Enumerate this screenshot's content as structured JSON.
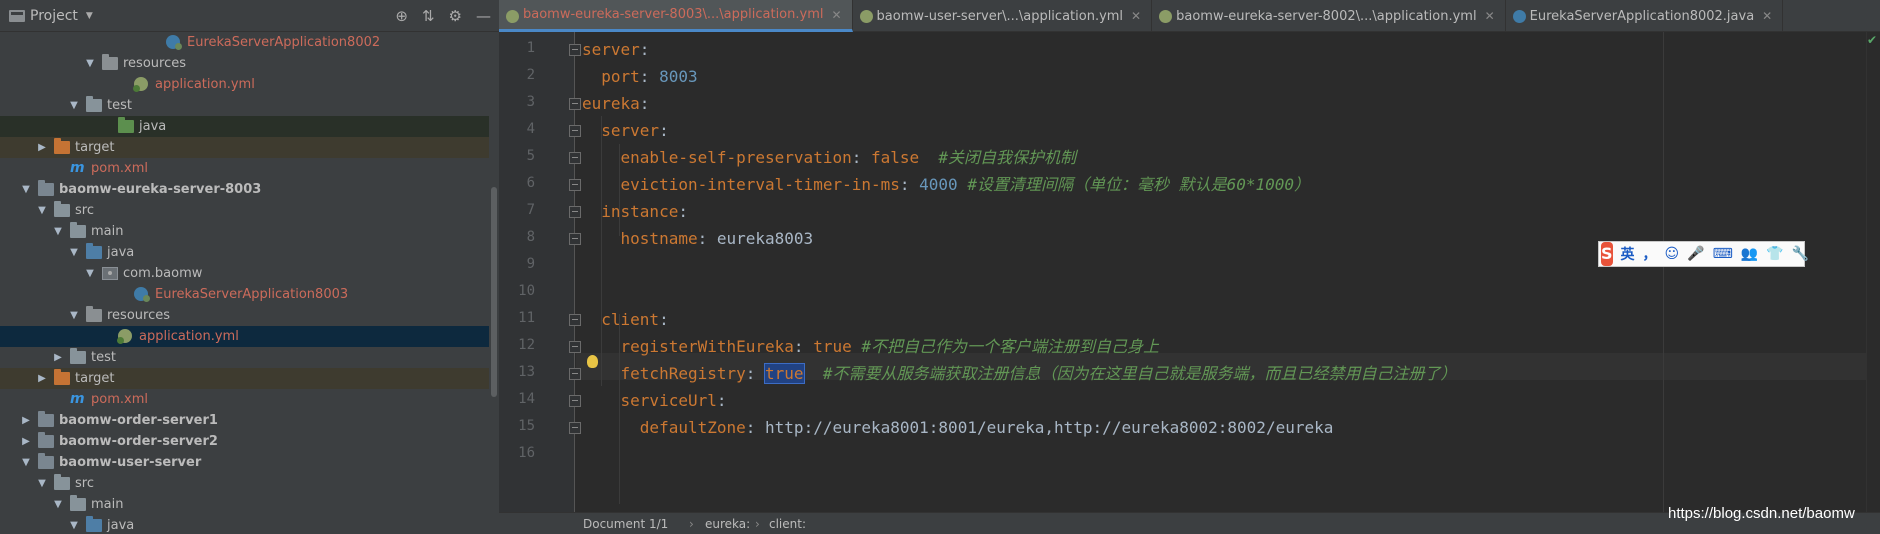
{
  "project_panel": {
    "title": "Project",
    "tools": [
      "target-icon",
      "collapse-icon",
      "gear-icon",
      "hide-icon"
    ],
    "tree": [
      {
        "indent": 9,
        "type": "class",
        "label": "EurekaServerApplication8002",
        "color": "red"
      },
      {
        "indent": 5,
        "arrow": "open",
        "type": "res",
        "label": "resources"
      },
      {
        "indent": 7,
        "type": "yml",
        "label": "application.yml",
        "color": "red"
      },
      {
        "indent": 4,
        "arrow": "open",
        "type": "folder",
        "label": "test"
      },
      {
        "indent": 6,
        "type": "green",
        "label": "java",
        "style": "hl"
      },
      {
        "indent": 2,
        "arrow": "closed",
        "type": "target",
        "label": "target",
        "style": "hl2"
      },
      {
        "indent": 3,
        "type": "maven",
        "label": "pom.xml",
        "color": "red"
      },
      {
        "indent": 1,
        "arrow": "open",
        "type": "module",
        "label": "baomw-eureka-server-8003",
        "bold": true
      },
      {
        "indent": 2,
        "arrow": "open",
        "type": "folder",
        "label": "src"
      },
      {
        "indent": 3,
        "arrow": "open",
        "type": "folder",
        "label": "main"
      },
      {
        "indent": 4,
        "arrow": "open",
        "type": "src",
        "label": "java"
      },
      {
        "indent": 5,
        "arrow": "open",
        "type": "pkg",
        "label": "com.baomw"
      },
      {
        "indent": 7,
        "type": "class",
        "label": "EurekaServerApplication8003",
        "color": "red"
      },
      {
        "indent": 4,
        "arrow": "open",
        "type": "res",
        "label": "resources"
      },
      {
        "indent": 6,
        "type": "yml",
        "label": "application.yml",
        "color": "red",
        "style": "sel"
      },
      {
        "indent": 3,
        "arrow": "closed",
        "type": "folder",
        "label": "test"
      },
      {
        "indent": 2,
        "arrow": "closed",
        "type": "target",
        "label": "target",
        "style": "hl2"
      },
      {
        "indent": 3,
        "type": "maven",
        "label": "pom.xml",
        "color": "red"
      },
      {
        "indent": 1,
        "arrow": "closed",
        "type": "module",
        "label": "baomw-order-server1",
        "bold": true
      },
      {
        "indent": 1,
        "arrow": "closed",
        "type": "module",
        "label": "baomw-order-server2",
        "bold": true
      },
      {
        "indent": 1,
        "arrow": "open",
        "type": "module",
        "label": "baomw-user-server",
        "bold": true
      },
      {
        "indent": 2,
        "arrow": "open",
        "type": "folder",
        "label": "src"
      },
      {
        "indent": 3,
        "arrow": "open",
        "type": "folder",
        "label": "main"
      },
      {
        "indent": 4,
        "arrow": "open",
        "type": "src",
        "label": "java"
      }
    ]
  },
  "tabs": [
    {
      "label": "baomw-eureka-server-8003\\...\\application.yml",
      "icon": "yml",
      "active": true
    },
    {
      "label": "baomw-user-server\\...\\application.yml",
      "icon": "yml"
    },
    {
      "label": "baomw-eureka-server-8002\\...\\application.yml",
      "icon": "yml"
    },
    {
      "label": "EurekaServerApplication8002.java",
      "icon": "java"
    }
  ],
  "editor": {
    "line_numbers": [
      "1",
      "2",
      "3",
      "4",
      "5",
      "6",
      "7",
      "8",
      "9",
      "10",
      "11",
      "12",
      "13",
      "14",
      "15",
      "16"
    ],
    "lines": [
      [
        {
          "t": "server",
          "c": "k"
        },
        {
          "t": ":",
          "c": "p"
        }
      ],
      [
        {
          "t": "  port",
          "c": "k"
        },
        {
          "t": ": ",
          "c": "p"
        },
        {
          "t": "8003",
          "c": "n"
        }
      ],
      [
        {
          "t": "eureka",
          "c": "k"
        },
        {
          "t": ":",
          "c": "p"
        }
      ],
      [
        {
          "t": "  server",
          "c": "k"
        },
        {
          "t": ":",
          "c": "p"
        }
      ],
      [
        {
          "t": "    enable-self-preservation",
          "c": "k"
        },
        {
          "t": ": ",
          "c": "p"
        },
        {
          "t": "false",
          "c": "b"
        },
        {
          "t": "  #关闭自我保护机制",
          "c": "c"
        }
      ],
      [
        {
          "t": "    eviction-interval-timer-in-ms",
          "c": "k"
        },
        {
          "t": ": ",
          "c": "p"
        },
        {
          "t": "4000",
          "c": "n"
        },
        {
          "t": " #设置清理间隔（单位：毫秒 默认是60*1000）",
          "c": "c"
        }
      ],
      [
        {
          "t": "  instance",
          "c": "k"
        },
        {
          "t": ":",
          "c": "p"
        }
      ],
      [
        {
          "t": "    hostname",
          "c": "k"
        },
        {
          "t": ": ",
          "c": "p"
        },
        {
          "t": "eureka8003",
          "c": "s"
        }
      ],
      [],
      [],
      [
        {
          "t": "  client",
          "c": "k"
        },
        {
          "t": ":",
          "c": "p"
        }
      ],
      [
        {
          "t": "    registerWithEureka",
          "c": "k"
        },
        {
          "t": ": ",
          "c": "p"
        },
        {
          "t": "true",
          "c": "b"
        },
        {
          "t": " #不把自己作为一个客户端注册到自己身上",
          "c": "c"
        }
      ],
      [
        {
          "t": "    fetchRegistry",
          "c": "k"
        },
        {
          "t": ": ",
          "c": "p"
        },
        {
          "t": "true",
          "c": "b",
          "sel": true
        },
        {
          "t": "  #不需要从服务端获取注册信息（因为在这里自己就是服务端，而且已经禁用自己注册了）",
          "c": "c"
        }
      ],
      [
        {
          "t": "    serviceUrl",
          "c": "k"
        },
        {
          "t": ":",
          "c": "p"
        }
      ],
      [
        {
          "t": "      defaultZone",
          "c": "k"
        },
        {
          "t": ": ",
          "c": "p"
        },
        {
          "t": "http://eureka8001:8001/eureka,http://eureka8002:8002/eureka",
          "c": "s"
        }
      ],
      []
    ]
  },
  "status": {
    "document": "Document 1/1",
    "sep": "›",
    "crumb1": "eureka:",
    "crumb2": "client:"
  },
  "ime": {
    "logo": "S",
    "lang": "英",
    "items": [
      "，",
      "☺",
      "🎤",
      "⌨",
      "👥",
      "👕",
      "🔧"
    ]
  },
  "watermark": "https://blog.csdn.net/baomw"
}
